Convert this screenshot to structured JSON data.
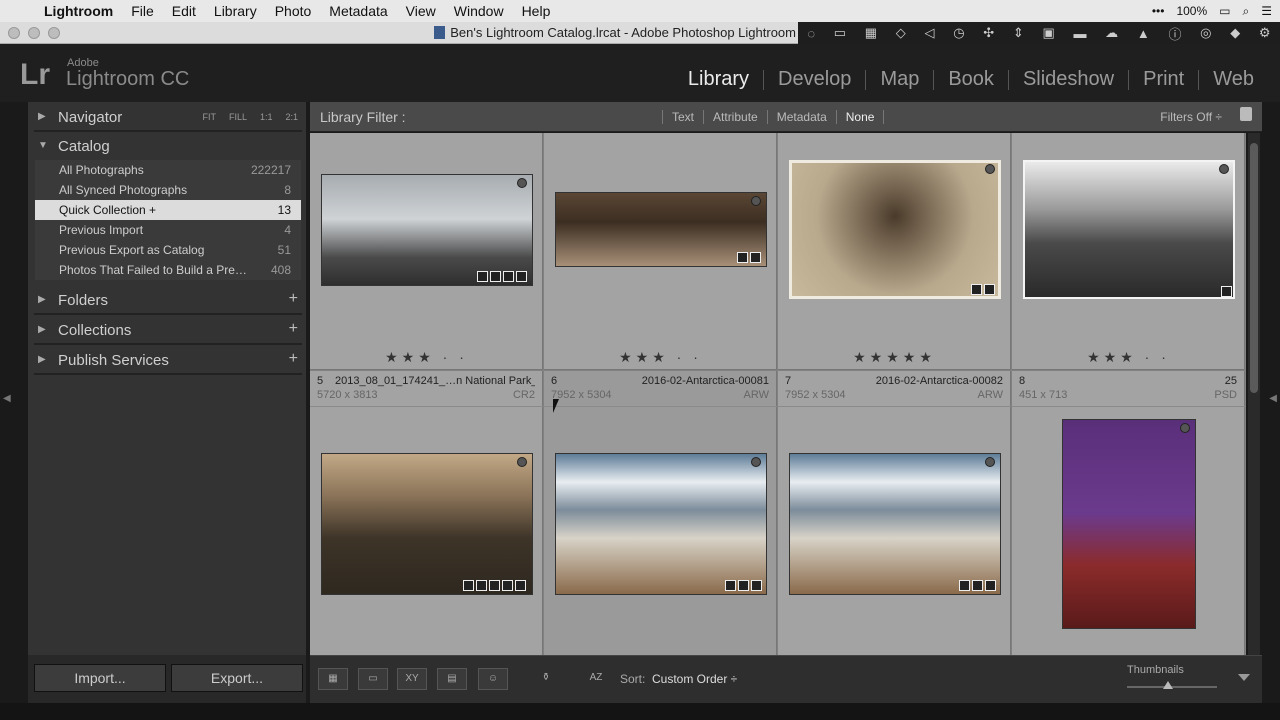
{
  "menubar": {
    "apple": "",
    "app": "Lightroom",
    "items": [
      "File",
      "Edit",
      "Library",
      "Photo",
      "Metadata",
      "View",
      "Window",
      "Help"
    ],
    "battery": "100%"
  },
  "window": {
    "title": "Ben's Lightroom Catalog.lrcat - Adobe Photoshop Lightroom"
  },
  "brand": {
    "logo": "Lr",
    "adobe": "Adobe",
    "product": "Lightroom CC"
  },
  "modules": [
    {
      "label": "Library",
      "active": true
    },
    {
      "label": "Develop"
    },
    {
      "label": "Map"
    },
    {
      "label": "Book"
    },
    {
      "label": "Slideshow"
    },
    {
      "label": "Print"
    },
    {
      "label": "Web"
    }
  ],
  "left": {
    "navigator": {
      "label": "Navigator",
      "zooms": [
        "FIT",
        "FILL",
        "1:1",
        "2:1"
      ]
    },
    "catalog": {
      "label": "Catalog",
      "items": [
        {
          "name": "All Photographs",
          "count": "222217"
        },
        {
          "name": "All Synced Photographs",
          "count": "8"
        },
        {
          "name": "Quick Collection +",
          "count": "13"
        },
        {
          "name": "Previous Import",
          "count": "4"
        },
        {
          "name": "Previous Export as Catalog",
          "count": "51"
        },
        {
          "name": "Photos That Failed to Build a Pre…",
          "count": "408"
        }
      ]
    },
    "folders": "Folders",
    "collections": "Collections",
    "publish": "Publish Services",
    "import": "Import...",
    "export": "Export..."
  },
  "filter": {
    "title": "Library Filter :",
    "tabs": [
      "Text",
      "Attribute",
      "Metadata",
      "None"
    ],
    "filters_off": "Filters Off ÷"
  },
  "grid": {
    "row1": [
      {
        "stars": "★★★ · ·",
        "colors": [
          "#5a5a5a",
          "#cfd3d6"
        ]
      },
      {
        "stars": "★★★ · ·",
        "colors": [
          "#3c2e22",
          "#a89078"
        ]
      },
      {
        "stars": "★★★★★",
        "colors": [
          "#b8a88c",
          "#4a3a2a"
        ]
      },
      {
        "stars": "★★★ · ·",
        "colors": [
          "#eaeaea",
          "#2a2a2a"
        ]
      }
    ],
    "row2": [
      {
        "idx": "5",
        "name": "2013_08_01_174241_…n National Park_0006",
        "dims": "5720 x 3813",
        "ext": "CR2",
        "colors": [
          "#c2a886",
          "#2e281f"
        ]
      },
      {
        "idx": "6",
        "name": "2016-02-Antarctica-00081",
        "dims": "7952 x 5304",
        "ext": "ARW",
        "colors": [
          "#5d7c97",
          "#d8d3c8"
        ]
      },
      {
        "idx": "7",
        "name": "2016-02-Antarctica-00082",
        "dims": "7952 x 5304",
        "ext": "ARW",
        "colors": [
          "#5d7c97",
          "#d8d3c8"
        ]
      },
      {
        "idx": "8",
        "name": "25",
        "dims": "451 x 713",
        "ext": "PSD",
        "colors": [
          "#5a2f7a",
          "#8b2b2b"
        ]
      }
    ]
  },
  "toolbar": {
    "sort_label": "Sort:",
    "sort_value": "Custom Order ÷",
    "thumbnails": "Thumbnails",
    "thumbnail_size": 0.45
  }
}
